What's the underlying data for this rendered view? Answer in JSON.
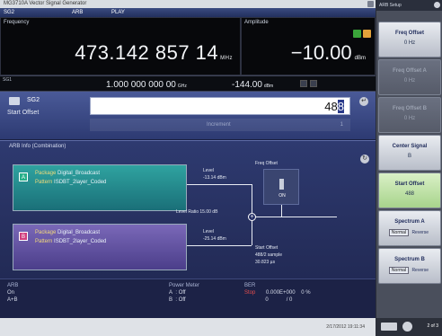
{
  "window": {
    "title": "MG3710A Vector Signal Generator"
  },
  "tabs": {
    "active": "SG2",
    "arb": "ARB",
    "play": "PLAY"
  },
  "frequency": {
    "label": "Frequency",
    "value": "473.142 857 14",
    "unit": "MHz"
  },
  "amplitude": {
    "label": "Amplitude",
    "value": "−10.00",
    "unit": "dBm"
  },
  "sg1": {
    "label": "SG1",
    "freq": "1.000 000 000 00",
    "freq_unit": "GHz",
    "amp": "-144.00",
    "amp_unit": "dBm"
  },
  "start_offset": {
    "sg": "SG2",
    "label": "Start Offset",
    "input_prefix": "48",
    "input_cursor": "8",
    "hint_left": "Increment",
    "hint_right": "1"
  },
  "arb_info": {
    "title": "ARB Info (Combination)",
    "package_label": "Package",
    "pattern_label": "Pattern",
    "a": {
      "badge": "A",
      "package": "Digital_Broadcast",
      "pattern": "ISDBT_2layer_Coded",
      "level_label": "Level",
      "level": "-13.14 dBm"
    },
    "b": {
      "badge": "B",
      "package": "Digital_Broadcast",
      "pattern": "ISDBT_2layer_Coded",
      "level_label": "Level",
      "level": "-25.14 dBm"
    },
    "level_ratio": "Level Ratio  15.00 dB",
    "freq_offset": "Freq Offset",
    "freq_offset_state": "ON",
    "start_offset_title": "Start Offset",
    "start_offset_samples": "488/2 sample",
    "start_offset_time": "30.823 µs"
  },
  "status": {
    "arb": {
      "title": "ARB",
      "l1": "On",
      "l2": "A+B"
    },
    "power": {
      "title": "Power Meter",
      "a_lbl": "A",
      "a_val": "Off",
      "b_lbl": "B",
      "b_val": "Off"
    },
    "ber": {
      "title": "BER",
      "stop": "Stop",
      "count": "0.000E+000",
      "pct": "0 %",
      "zero": "0",
      "ratio": "/ 0"
    }
  },
  "footer": {
    "timestamp": "2/17/2012 19:11:34"
  },
  "side": {
    "title": "ARB Setup",
    "keys": [
      {
        "label": "Freq Offset",
        "value": "0 Hz"
      },
      {
        "label": "Freq Offset A",
        "value": "0 Hz"
      },
      {
        "label": "Freq Offset B",
        "value": "0 Hz"
      },
      {
        "label": "Center Signal",
        "value": "B"
      },
      {
        "label": "Start Offset",
        "value": "488"
      },
      {
        "label": "Spectrum A",
        "opt1": "Normal",
        "opt2": "Reverse"
      },
      {
        "label": "Spectrum B",
        "opt1": "Normal",
        "opt2": "Reverse"
      }
    ],
    "page": "2 of 3"
  }
}
